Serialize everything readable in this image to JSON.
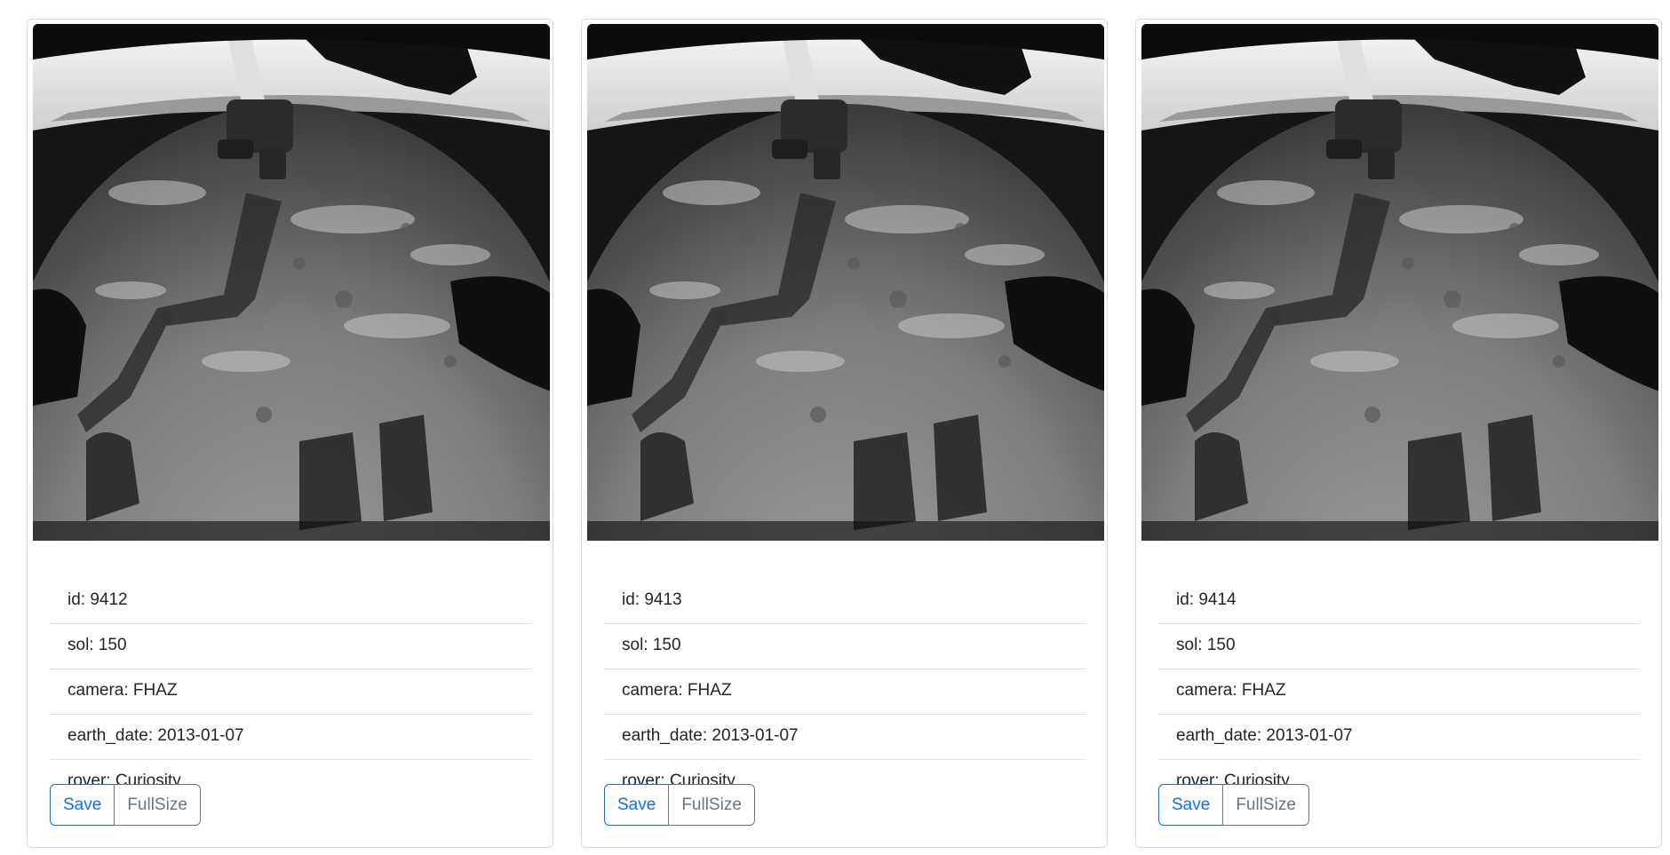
{
  "photos": [
    {
      "id_text": "id: 9412",
      "sol_text": "sol: 150",
      "camera_text": "camera: FHAZ",
      "earth_date_text": "earth_date: 2013-01-07",
      "rover_text": "rover: Curiosity",
      "save_label": "Save",
      "fullsize_label": "FullSize"
    },
    {
      "id_text": "id: 9413",
      "sol_text": "sol: 150",
      "camera_text": "camera: FHAZ",
      "earth_date_text": "earth_date: 2013-01-07",
      "rover_text": "rover: Curiosity",
      "save_label": "Save",
      "fullsize_label": "FullSize"
    },
    {
      "id_text": "id: 9414",
      "sol_text": "sol: 150",
      "camera_text": "camera: FHAZ",
      "earth_date_text": "earth_date: 2013-01-07",
      "rover_text": "rover: Curiosity",
      "save_label": "Save",
      "fullsize_label": "FullSize"
    }
  ],
  "colors": {
    "primary": "#0d6efd",
    "secondary": "#6c757d",
    "border": "#dee2e6"
  }
}
